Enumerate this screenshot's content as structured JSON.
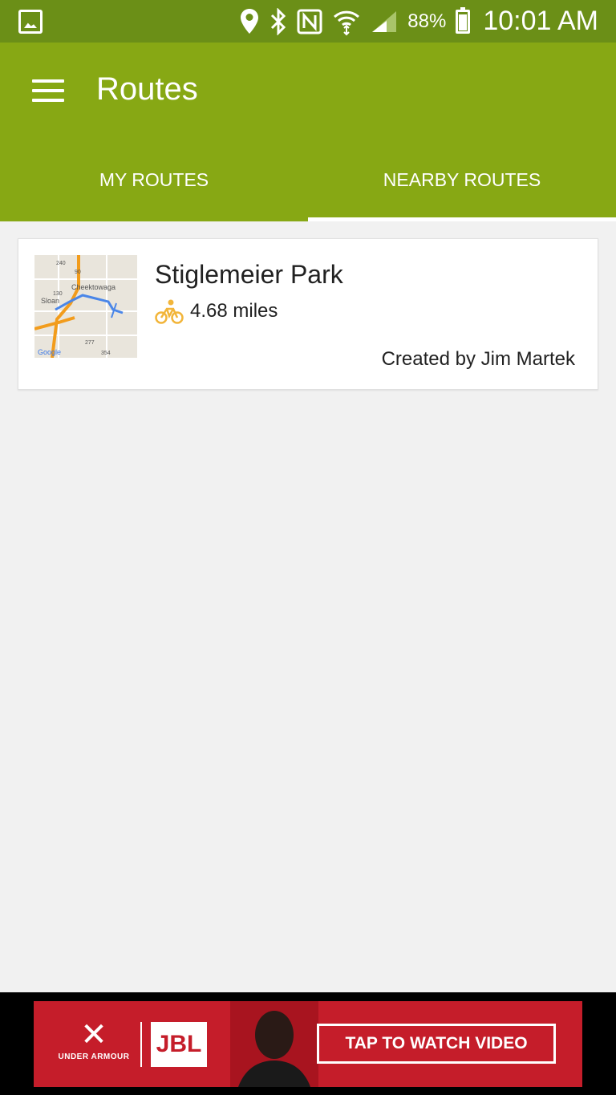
{
  "status_bar": {
    "battery_percent": "88%",
    "time": "10:01 AM"
  },
  "app_bar": {
    "title": "Routes"
  },
  "tabs": [
    {
      "label": "MY ROUTES",
      "active": false
    },
    {
      "label": "NEARBY ROUTES",
      "active": true
    }
  ],
  "routes": [
    {
      "name": "Stiglemeier Park",
      "activity_icon": "bicycle-icon",
      "distance": "4.68 miles",
      "created_by": "Created by Jim Martek",
      "map_labels": {
        "town_1": "Cheektowaga",
        "town_2": "Sloan",
        "route_240": "240",
        "route_90": "90",
        "route_130": "130",
        "route_277": "277",
        "route_354": "354",
        "attribution": "Google"
      }
    }
  ],
  "ad": {
    "brand_1": "UNDER ARMOUR",
    "brand_2": "JBL",
    "cta": "TAP TO WATCH VIDEO"
  },
  "colors": {
    "status_bar": "#6b8f17",
    "app_bar": "#87a814",
    "accent_icon": "#f2b53a",
    "ad_background": "#c51d2a"
  }
}
